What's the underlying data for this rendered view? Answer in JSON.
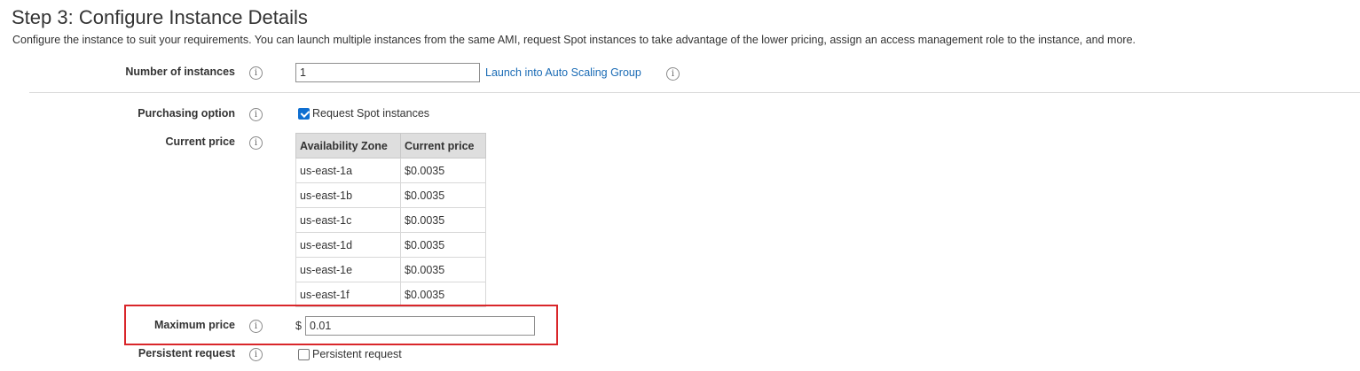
{
  "header": {
    "title": "Step 3: Configure Instance Details",
    "subtitle": "Configure the instance to suit your requirements. You can launch multiple instances from the same AMI, request Spot instances to take advantage of the lower pricing, assign an access management role to the instance, and more."
  },
  "form": {
    "number_of_instances": {
      "label": "Number of instances",
      "value": "1",
      "link": "Launch into Auto Scaling Group"
    },
    "purchasing_option": {
      "label": "Purchasing option",
      "checkbox_label": "Request Spot instances",
      "checked": true
    },
    "current_price": {
      "label": "Current price",
      "columns": [
        "Availability Zone",
        "Current price"
      ],
      "rows": [
        [
          "us-east-1a",
          "$0.0035"
        ],
        [
          "us-east-1b",
          "$0.0035"
        ],
        [
          "us-east-1c",
          "$0.0035"
        ],
        [
          "us-east-1d",
          "$0.0035"
        ],
        [
          "us-east-1e",
          "$0.0035"
        ],
        [
          "us-east-1f",
          "$0.0035"
        ]
      ]
    },
    "maximum_price": {
      "label": "Maximum price",
      "currency": "$",
      "value": "0.01"
    },
    "persistent_request": {
      "label": "Persistent request",
      "checkbox_label": "Persistent request",
      "checked": false
    }
  },
  "icons": {
    "info": "i"
  },
  "colors": {
    "link": "#1a6bb5",
    "highlight_border": "#d9262a",
    "checkbox_checked": "#0f6fd1",
    "table_header_bg": "#dedede"
  }
}
